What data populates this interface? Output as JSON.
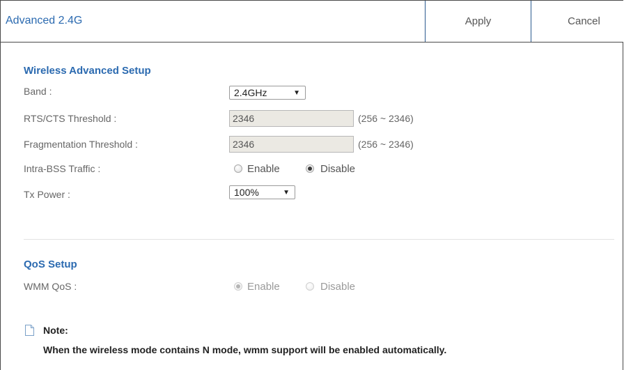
{
  "header": {
    "title": "Advanced 2.4G",
    "apply_label": "Apply",
    "cancel_label": "Cancel"
  },
  "wireless": {
    "section_title": "Wireless Advanced Setup",
    "band": {
      "label": "Band :",
      "value": "2.4GHz"
    },
    "rts": {
      "label": "RTS/CTS Threshold :",
      "value": "2346",
      "range": "(256 ~ 2346)"
    },
    "frag": {
      "label": "Fragmentation Threshold :",
      "value": "2346",
      "range": "(256 ~ 2346)"
    },
    "intra_bss": {
      "label": "Intra-BSS Traffic :",
      "enable_label": "Enable",
      "disable_label": "Disable",
      "selected": "Disable"
    },
    "tx_power": {
      "label": "Tx Power :",
      "value": "100%"
    }
  },
  "qos": {
    "section_title": "QoS Setup",
    "wmm": {
      "label": "WMM QoS :",
      "enable_label": "Enable",
      "disable_label": "Disable",
      "selected": "Enable",
      "disabled": true
    }
  },
  "note": {
    "title": "Note:",
    "text": "When the wireless mode contains N mode, wmm support will be enabled automatically."
  },
  "icons": {
    "dropdown_arrow": "chevron-down-icon",
    "note": "document-icon"
  },
  "colors": {
    "accent": "#2b6ab0",
    "border": "#4a4a4a"
  }
}
